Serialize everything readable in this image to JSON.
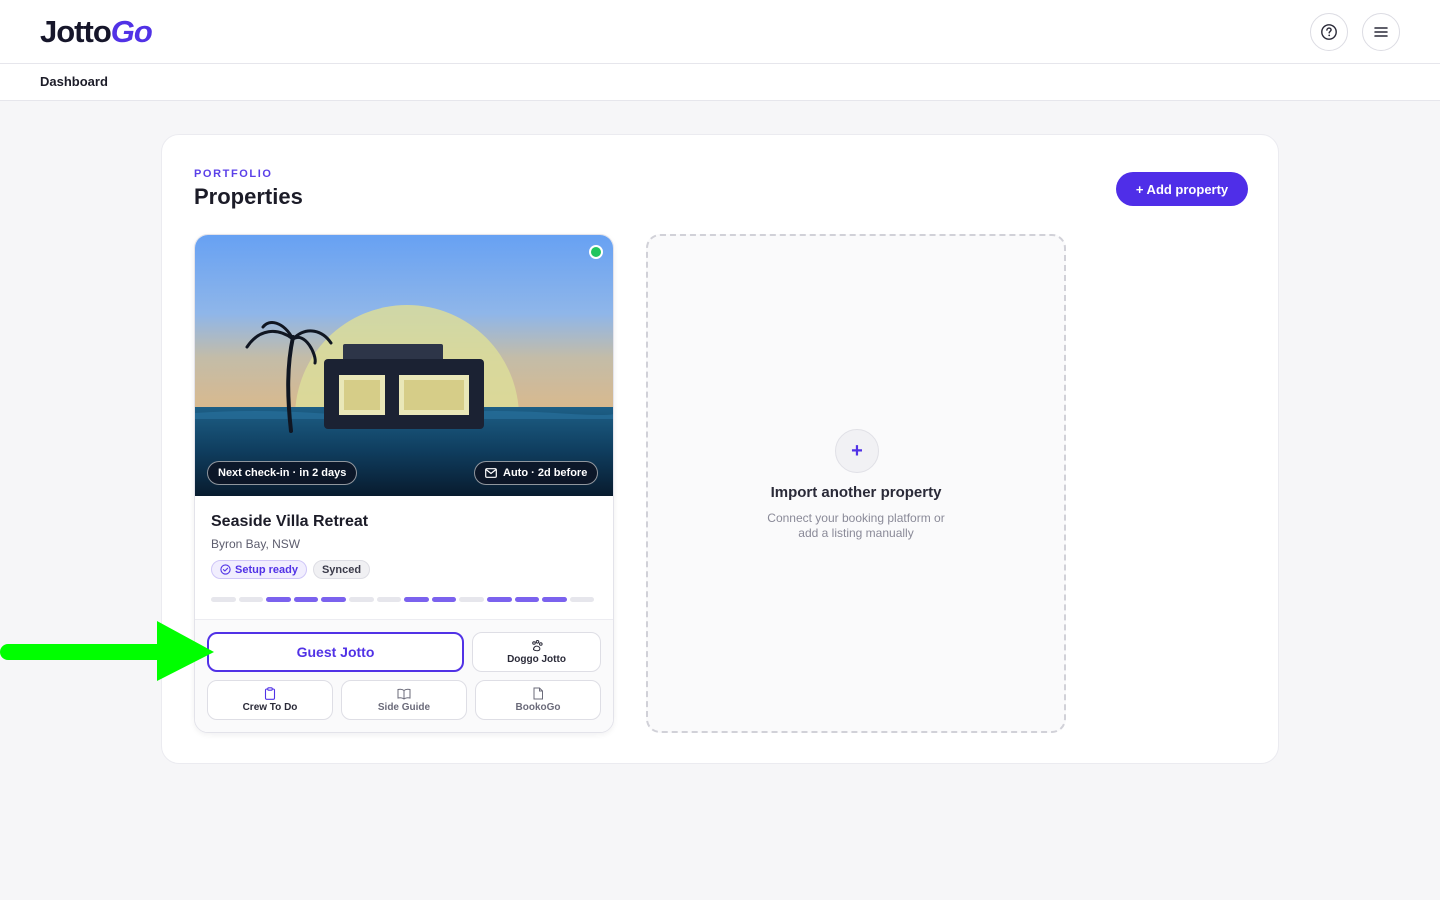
{
  "header": {
    "logo_part1": "Jotto",
    "logo_part2": "Go",
    "help_icon": "help-circle-icon",
    "menu_icon": "hamburger-menu-icon"
  },
  "breadcrumb": "Dashboard",
  "portfolio": {
    "eyebrow": "PORTFOLIO",
    "title": "Properties",
    "add_button": "+ Add property"
  },
  "property": {
    "name": "Seaside Villa Retreat",
    "location": "Byron Bay, NSW",
    "next_checkin": "Next check-in · in 2 days",
    "auto_message": "Auto · 2d before",
    "status_online": true,
    "badges": {
      "setup": "Setup ready",
      "synced": "Synced"
    },
    "progress_segments": [
      false,
      false,
      true,
      true,
      true,
      false,
      false,
      true,
      true,
      false,
      true,
      true,
      true,
      false
    ],
    "actions": {
      "guest": "Guest Jotto",
      "doggo": "Doggo Jotto",
      "crew": "Crew To Do",
      "guide": "Side Guide",
      "booko": "BookoGo"
    }
  },
  "import_card": {
    "plus": "+",
    "title": "Import another property",
    "description": "Connect your booking platform or add a listing manually"
  },
  "colors": {
    "brand": "#5132e6",
    "accent_button": "#4f2ee8",
    "online": "#22c55e",
    "annotation_arrow": "#00ff00"
  }
}
